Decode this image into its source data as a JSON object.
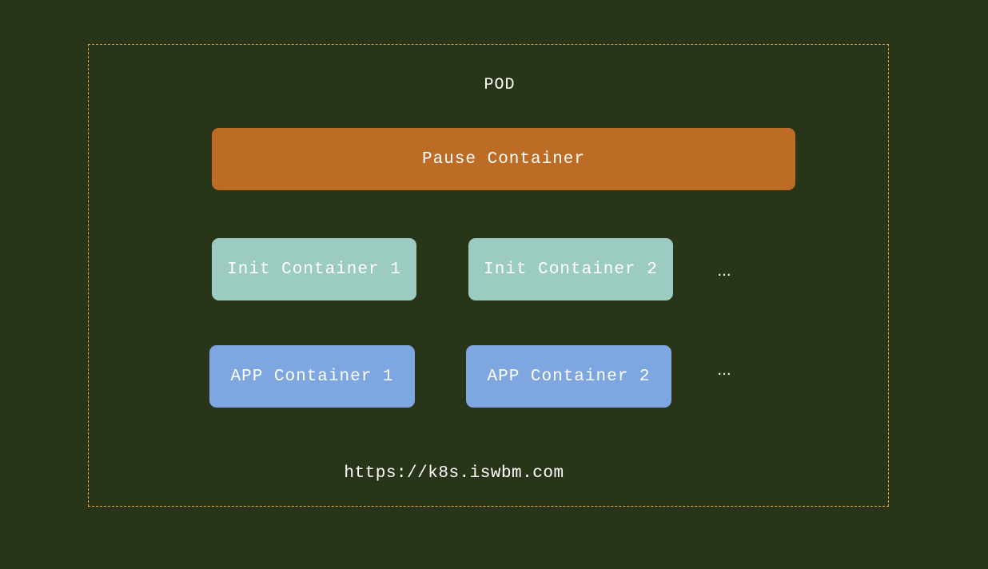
{
  "pod": {
    "label": "POD",
    "border_color": "#e8a94c"
  },
  "pause_container": {
    "label": "Pause Container",
    "color": "#bc6c25"
  },
  "init_containers": [
    {
      "label": "Init Container 1"
    },
    {
      "label": "Init Container 2"
    }
  ],
  "init_more": "...",
  "app_containers": [
    {
      "label": "APP Container 1"
    },
    {
      "label": "APP Container 2"
    }
  ],
  "app_more": "...",
  "colors": {
    "background": "#283518",
    "init": "#9ccbc1",
    "app": "#7ea6e0"
  },
  "url": "https://k8s.iswbm.com"
}
